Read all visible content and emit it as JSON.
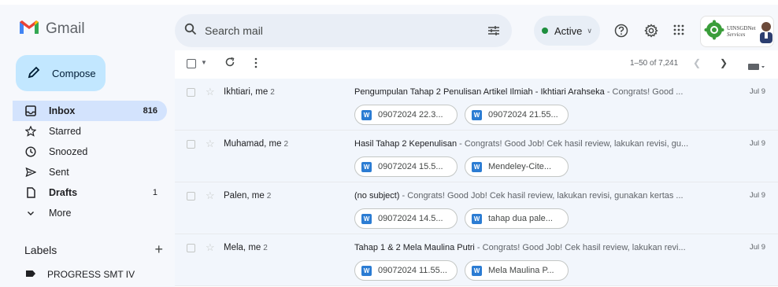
{
  "app": {
    "name": "Gmail"
  },
  "search": {
    "placeholder": "Search mail"
  },
  "status": {
    "label": "Active"
  },
  "org": {
    "line1": "UINSGDNet",
    "line2": "Services"
  },
  "colors": {
    "compose_bg": "#c2e7ff",
    "active_nav_bg": "#d3e3fd",
    "status_dot": "#1e8e3e",
    "word_icon": "#2b7cd3"
  },
  "compose": {
    "label": "Compose",
    "icon": "pencil-icon"
  },
  "nav": [
    {
      "label": "Inbox",
      "count": "816",
      "icon": "inbox-icon"
    },
    {
      "label": "Starred",
      "count": "",
      "icon": "star-icon"
    },
    {
      "label": "Snoozed",
      "count": "",
      "icon": "clock-icon"
    },
    {
      "label": "Sent",
      "count": "",
      "icon": "send-icon"
    },
    {
      "label": "Drafts",
      "count": "1",
      "icon": "file-icon"
    },
    {
      "label": "More",
      "count": "",
      "icon": "chevron-down-icon"
    }
  ],
  "labels": {
    "heading": "Labels",
    "add": "+",
    "items": [
      {
        "label": "PROGRESS SMT IV",
        "icon": "label-icon"
      }
    ]
  },
  "toolbar": {
    "pager": "1–50 of 7,241"
  },
  "emails": [
    {
      "sender": "Ikhtiari, me",
      "count": "2",
      "subject": "Pengumpulan Tahap 2 Penulisan Artikel Ilmiah - Ikhtiari Arahseka",
      "snippet": " - Congrats! Good ...",
      "date": "Jul 9",
      "attachments": [
        "09072024 22.3...",
        "09072024 21.55..."
      ]
    },
    {
      "sender": "Muhamad, me",
      "count": "2",
      "subject": "Hasil Tahap 2 Kepenulisan",
      "snippet": " - Congrats! Good Job! Cek hasil review, lakukan revisi, gu...",
      "date": "Jul 9",
      "attachments": [
        "09072024 15.5...",
        "Mendeley-Cite..."
      ]
    },
    {
      "sender": "Palen, me",
      "count": "2",
      "subject": "(no subject)",
      "snippet": " - Congrats! Good Job! Cek hasil review, lakukan revisi, gunakan kertas ...",
      "date": "Jul 9",
      "attachments": [
        "09072024 14.5...",
        "tahap dua pale..."
      ]
    },
    {
      "sender": "Mela, me",
      "count": "2",
      "subject": "Tahap 1 & 2 Mela Maulina Putri",
      "snippet": " - Congrats! Good Job! Cek hasil review, lakukan revi...",
      "date": "Jul 9",
      "attachments": [
        "09072024 11.55...",
        "Mela Maulina P..."
      ]
    }
  ],
  "attachment_icon": "W"
}
